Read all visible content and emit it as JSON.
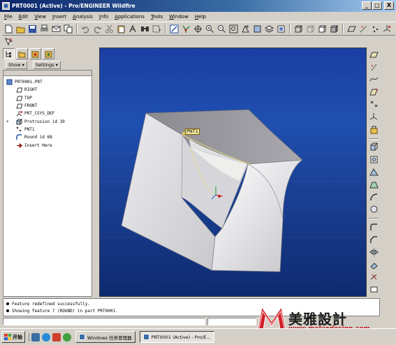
{
  "window": {
    "title": "PRT0001 (Active) - Pro/ENGINEER Wildfire",
    "minimize": "_",
    "maximize": "□",
    "close": "X"
  },
  "menu": [
    "File",
    "Edit",
    "View",
    "Insert",
    "Analysis",
    "Info",
    "Applications",
    "Tools",
    "Window",
    "Help"
  ],
  "toolbar": {
    "icons": [
      "new-icon",
      "open-icon",
      "save-icon",
      "print-icon",
      "email-icon",
      "copy-icon",
      "undo-icon",
      "redo-icon",
      "cut-icon",
      "copy-icon",
      "paste-icon",
      "regenerate-icon",
      "find-icon",
      "select-box-icon",
      "repaint-icon",
      "spin-center-icon",
      "orient-icon",
      "zoom-in-icon",
      "zoom-out-icon",
      "refit-icon",
      "reorient-icon",
      "saved-views-icon",
      "layers-icon",
      "view-manager-icon",
      "wireframe-icon",
      "hidden-line-icon",
      "no-hidden-icon",
      "shading-icon",
      "datum-plane-display-icon",
      "datum-axis-display-icon",
      "datum-point-display-icon",
      "csys-display-icon"
    ],
    "help_icon": "whats-this-icon"
  },
  "model_tree": {
    "show_label": "Show",
    "settings_label": "Settings",
    "root": "PRT0001.PRT",
    "items": [
      {
        "label": "RIGHT",
        "icon": "datum-plane-icon",
        "expander": ""
      },
      {
        "label": "TOP",
        "icon": "datum-plane-icon",
        "expander": ""
      },
      {
        "label": "FRONT",
        "icon": "datum-plane-icon",
        "expander": ""
      },
      {
        "label": "PRT_CSYS_DEF",
        "icon": "csys-icon",
        "expander": ""
      },
      {
        "label": "Protrusion id 39",
        "icon": "protrusion-icon",
        "expander": "+"
      },
      {
        "label": "PNT1",
        "icon": "datum-point-icon",
        "expander": ""
      },
      {
        "label": "Round id 68",
        "icon": "round-icon",
        "expander": ""
      },
      {
        "label": "Insert Here",
        "icon": "insert-here-icon",
        "expander": ""
      }
    ]
  },
  "viewport": {
    "point_label": "PNT1"
  },
  "messages": [
    "Feature redefined successfully.",
    "Showing feature 7 (ROUND) in part PRT0001."
  ],
  "watermark": {
    "cn": "美雅設計",
    "url": "www.melyadesign.com"
  },
  "taskbar": {
    "start": "开始",
    "tasks": [
      {
        "label": "Windows 任务管理器",
        "active": false
      },
      {
        "label": "PRT0001 (Active) - Pro/E...",
        "active": true
      }
    ]
  },
  "colors": {
    "title_bar": "#0a246a",
    "viewport_bg": "#1f4fb0",
    "model_surface": "#d9d9dc",
    "watermark_red": "#c0141e"
  }
}
